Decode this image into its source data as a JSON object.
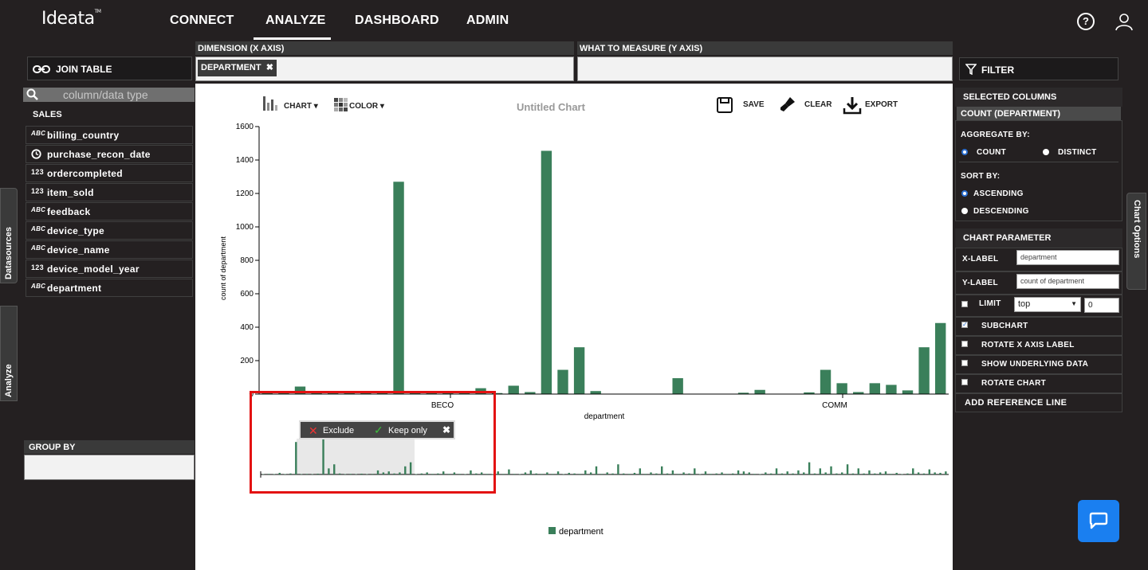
{
  "app": {
    "logo": "Ideata",
    "logo_tm": "TM"
  },
  "nav": {
    "items": [
      "CONNECT",
      "ANALYZE",
      "DASHBOARD",
      "ADMIN"
    ],
    "active": "ANALYZE",
    "help": "?"
  },
  "left": {
    "join_table": "JOIN TABLE",
    "search_placeholder": "column/data type",
    "table_name": "SALES",
    "fields": [
      {
        "name": "billing_country",
        "type": "ABC"
      },
      {
        "name": "purchase_recon_date",
        "type": "clock"
      },
      {
        "name": "ordercompleted",
        "type": "123"
      },
      {
        "name": "item_sold",
        "type": "123"
      },
      {
        "name": "feedback",
        "type": "ABC"
      },
      {
        "name": "device_type",
        "type": "ABC"
      },
      {
        "name": "device_name",
        "type": "ABC"
      },
      {
        "name": "device_model_year",
        "type": "123"
      },
      {
        "name": "department",
        "type": "ABC"
      }
    ],
    "tab_datasources": "Datasources",
    "tab_analyze": "Analyze",
    "group_by": "GROUP BY"
  },
  "axes": {
    "dimension_label": "DIMENSION (X AXIS)",
    "dimension_chip": "DEPARTMENT",
    "measure_label": "WHAT TO MEASURE (Y AXIS)"
  },
  "toolbar": {
    "chart": "CHART",
    "color": "COLOR",
    "title": "Untitled Chart",
    "save": "SAVE",
    "clear": "CLEAR",
    "export": "EXPORT"
  },
  "tooltip": {
    "exclude": "Exclude",
    "keep_only": "Keep only"
  },
  "colors": {
    "bar": "#3a7f5a",
    "accent_red": "#e31212",
    "chat": "#1a7ff0"
  },
  "chart_data": {
    "type": "bar",
    "title": "Untitled Chart",
    "xlabel": "department",
    "ylabel": "count of department",
    "ylim": [
      0,
      1600
    ],
    "yticks": [
      0,
      200,
      400,
      600,
      800,
      1000,
      1200,
      1400,
      1600
    ],
    "x_tick_labels": [
      "BECO",
      "COMM"
    ],
    "legend": "department",
    "series": [
      {
        "name": "department",
        "values": [
          10,
          5,
          45,
          8,
          6,
          5,
          5,
          5,
          1270,
          5,
          8,
          6,
          5,
          35,
          6,
          50,
          12,
          1455,
          145,
          280,
          18,
          0,
          0,
          0,
          0,
          95,
          0,
          0,
          0,
          8,
          25,
          0,
          0,
          10,
          145,
          65,
          12,
          65,
          55,
          22,
          280,
          425
        ]
      }
    ],
    "subchart_values": [
      2,
      3,
      2,
      8,
      2,
      5,
      160,
      2,
      3,
      2,
      4,
      200,
      30,
      50,
      5,
      2,
      3,
      2,
      4,
      2,
      3,
      20,
      10,
      15,
      5,
      10,
      40,
      60,
      2,
      5,
      10,
      3,
      5,
      15,
      3,
      10,
      3,
      2,
      20,
      5,
      10,
      3,
      2,
      15,
      3,
      25,
      3,
      2,
      10,
      20,
      5,
      3,
      10,
      3,
      15,
      2,
      8,
      5,
      3,
      20,
      10,
      40,
      3,
      10,
      5,
      50,
      5,
      3,
      8,
      30,
      3,
      10,
      5,
      40,
      5,
      20,
      3,
      10,
      5,
      30,
      2,
      15,
      3,
      5,
      10,
      3,
      5,
      20,
      15,
      10,
      3,
      2,
      10,
      5,
      30,
      5,
      15,
      5,
      20,
      10,
      60,
      5,
      30,
      10,
      40,
      5,
      10,
      50,
      5,
      30,
      5,
      20,
      5,
      10,
      15,
      3,
      8,
      2,
      5,
      30,
      10,
      5,
      25,
      10,
      8,
      15
    ]
  },
  "right": {
    "filter": "FILTER",
    "selected_columns": "SELECTED COLUMNS",
    "selected_item": "COUNT (DEPARTMENT)",
    "aggregate_by": "AGGREGATE BY:",
    "agg_options": [
      "COUNT",
      "DISTINCT"
    ],
    "agg_selected": "COUNT",
    "sort_by": "SORT BY:",
    "sort_options": [
      "ASCENDING",
      "DESCENDING"
    ],
    "sort_selected": "ASCENDING",
    "chart_parameter": "CHART PARAMETER",
    "x_label": "X-LABEL",
    "x_label_value": "department",
    "y_label": "Y-LABEL",
    "y_label_value": "count of department",
    "limit": "LIMIT",
    "limit_select": "top",
    "limit_value": "0",
    "subchart": "SUBCHART",
    "subchart_checked": true,
    "rotate_x": "ROTATE X AXIS LABEL",
    "show_underlying": "SHOW UNDERLYING DATA",
    "rotate_chart": "ROTATE CHART",
    "add_reference": "ADD REFERENCE LINE",
    "tab_chart_options": "Chart Options"
  }
}
